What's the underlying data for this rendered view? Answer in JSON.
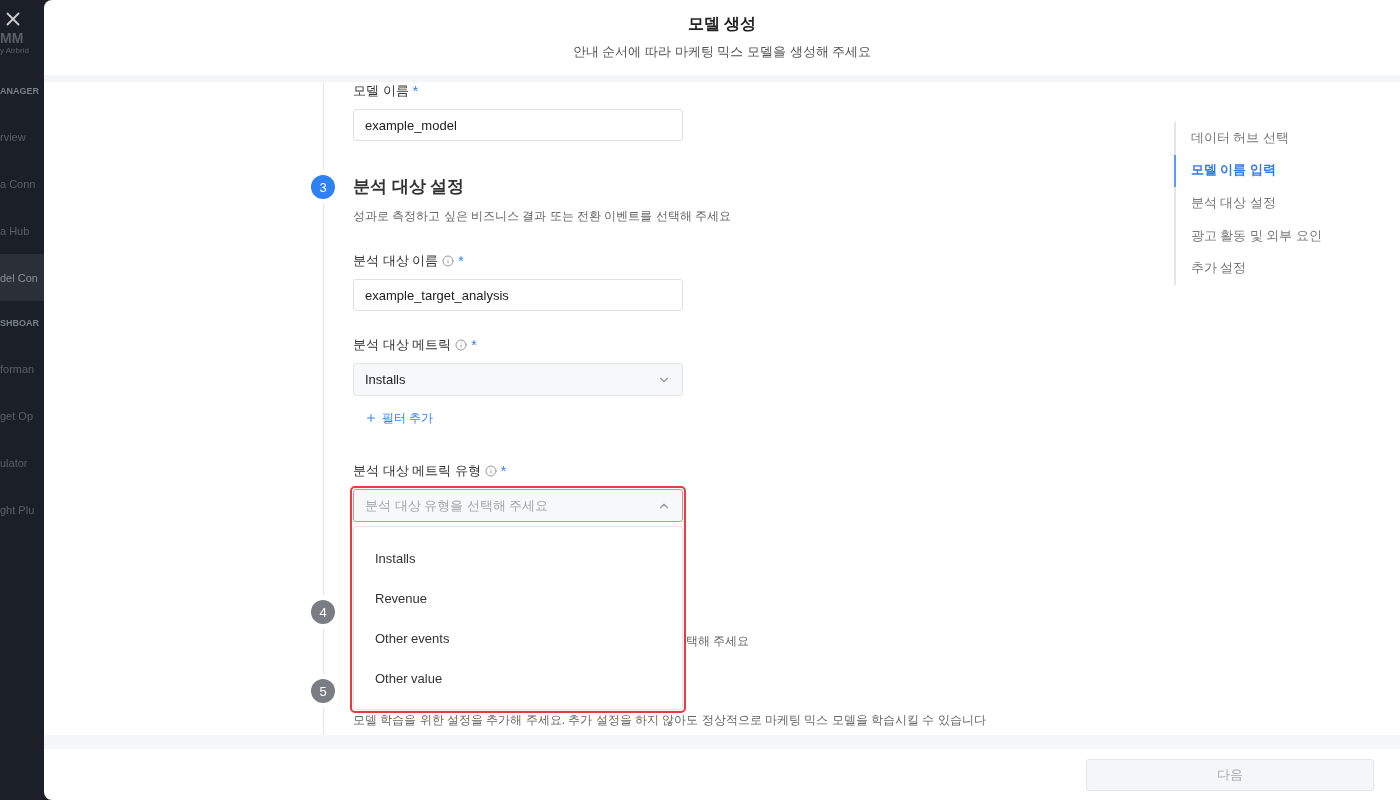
{
  "sidebar": {
    "logo": "MM",
    "logo_sub": "y Airbrid",
    "items": [
      {
        "kind": "section",
        "label": "ANAGER",
        "selected": false
      },
      {
        "kind": "item",
        "label": "rview",
        "selected": false
      },
      {
        "kind": "item",
        "label": "a Conn",
        "selected": false
      },
      {
        "kind": "item",
        "label": "a Hub",
        "selected": false
      },
      {
        "kind": "item",
        "label": "del Con",
        "selected": true
      },
      {
        "kind": "section",
        "label": "SHBOAR",
        "selected": false
      },
      {
        "kind": "item",
        "label": "forman",
        "selected": false
      },
      {
        "kind": "item",
        "label": "get Op",
        "selected": false
      },
      {
        "kind": "item",
        "label": "ulator",
        "selected": false
      },
      {
        "kind": "item",
        "label": "ght Plu",
        "selected": false
      }
    ]
  },
  "modal": {
    "title": "모델 생성",
    "subtitle": "안내 순서에 따라 마케팅 믹스 모델을 생성해 주세요"
  },
  "model_name": {
    "label": "모델 이름",
    "required_mark": "*",
    "value": "example_model"
  },
  "steps": [
    {
      "number": "3",
      "kind": "full",
      "active": true,
      "title": "분석 대상 설정",
      "description": "성과로 측정하고 싶은 비즈니스 결과 또는 전환 이벤트를 선택해 주세요",
      "fields": [
        {
          "kind": "text",
          "label": "분석 대상 이름",
          "info": true,
          "required_mark": "*",
          "value": "example_target_analysis"
        },
        {
          "kind": "select",
          "label": "분석 대상 메트릭",
          "info": true,
          "required_mark": "*",
          "value": "Installs",
          "expanded": false,
          "highlighted": false,
          "add_filter": "필터 추가"
        },
        {
          "kind": "select",
          "label": "분석 대상 메트릭 유형",
          "info": true,
          "required_mark": "*",
          "placeholder": "분석 대상 유형을 선택해 주세요",
          "expanded": true,
          "highlighted": true,
          "options": [
            "Installs",
            "Revenue",
            "Other events",
            "Other value"
          ]
        }
      ]
    },
    {
      "number": "4",
      "kind": "covered",
      "active": false,
      "description": "택해 주세요"
    },
    {
      "number": "5",
      "kind": "plain",
      "active": false,
      "description": "모델 학습을 위한 설정을 추가해 주세요. 추가 설정을 하지 않아도 정상적으로 마케팅 믹스 모델을 학습시킬 수 있습니다"
    }
  ],
  "nav": [
    {
      "label": "데이터 허브 선택",
      "selected": false
    },
    {
      "label": "모델 이름 입력",
      "selected": true
    },
    {
      "label": "분석 대상 설정",
      "selected": false
    },
    {
      "label": "광고 활동 및 외부 요인",
      "selected": false
    },
    {
      "label": "추가 설정",
      "selected": false
    }
  ],
  "footer": {
    "next_button": "다음",
    "disabled": true
  }
}
